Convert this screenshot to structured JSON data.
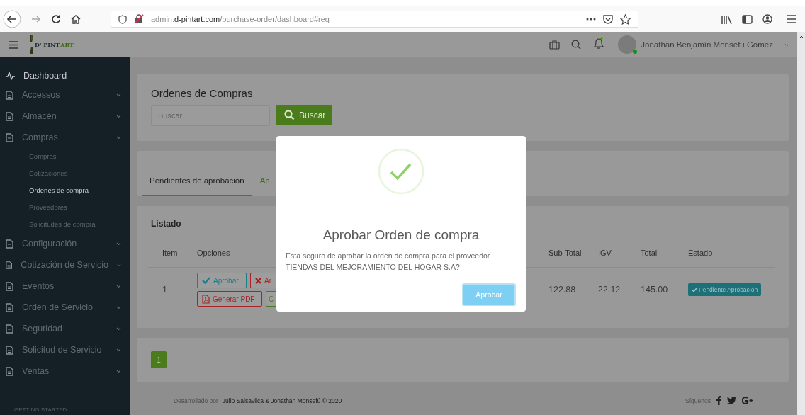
{
  "browser": {
    "url": {
      "prefix": "admin.",
      "domain": "d-pintart.com",
      "path": "/purchase-order/dashboard#req"
    }
  },
  "header": {
    "logo": {
      "part_1": "D' PINT",
      "part_2": "ART"
    },
    "user_name": "Jonathan Benjamín Monsefu Gomez"
  },
  "sidebar": {
    "items": [
      {
        "label": "Dashboard",
        "kind": "link"
      },
      {
        "label": "Accessos",
        "kind": "group"
      },
      {
        "label": "Almacén",
        "kind": "group"
      },
      {
        "label": "Compras",
        "kind": "group",
        "children": [
          {
            "label": "Compras",
            "selected": false
          },
          {
            "label": "Cotizaciones",
            "selected": false
          },
          {
            "label": "Ordenes de compra",
            "selected": true
          },
          {
            "label": "Proveedores",
            "selected": false
          },
          {
            "label": "Solicitudes de compra",
            "selected": false
          }
        ]
      },
      {
        "label": "Configuración",
        "kind": "group"
      },
      {
        "label": "Cotización de Servicio",
        "kind": "group"
      },
      {
        "label": "Eventos",
        "kind": "group"
      },
      {
        "label": "Orden de Servicio",
        "kind": "group"
      },
      {
        "label": "Seguridad",
        "kind": "group"
      },
      {
        "label": "Solicitud de Servicio",
        "kind": "group"
      },
      {
        "label": "Ventas",
        "kind": "group"
      }
    ],
    "section_label": "GETTING STARTED"
  },
  "page": {
    "title": "Ordenes de Compras",
    "search": {
      "placeholder": "Buscar",
      "button": "Buscar"
    },
    "tabs": [
      {
        "label": "Pendientes de aprobación",
        "selected": true
      },
      {
        "label": "Ap",
        "selected": false
      }
    ],
    "listado": {
      "title": "Listado",
      "columns": [
        "Item",
        "Opciones",
        "Sub-Total",
        "IGV",
        "Total",
        "Estado"
      ],
      "rows": [
        {
          "item": "1",
          "actions": [
            {
              "label": "Aprobar",
              "kind": "approve"
            },
            {
              "label": "Ar",
              "kind": "cancel"
            },
            {
              "label": "Generar PDF",
              "kind": "pdf"
            },
            {
              "label": "C",
              "kind": "other"
            }
          ],
          "sub_total": "122.88",
          "igv": "22.12",
          "total": "145.00",
          "status": "Pendiente Aprobación"
        }
      ]
    },
    "pagination": [
      {
        "label": "1",
        "selected": true
      }
    ],
    "footer": {
      "prefix": "Desarrollado por",
      "credits": "Julio Salsavilca & Jonathan Monsefú © 2020",
      "follow": "Síguenos"
    }
  },
  "modal": {
    "title": "Aprobar Orden de compra",
    "message": "Esta seguro de aprobar la orden de compra para el proveedor TIENDAS DEL MEJORAMIENTO DEL HOGAR S.A?",
    "button": "Aprobar"
  }
}
